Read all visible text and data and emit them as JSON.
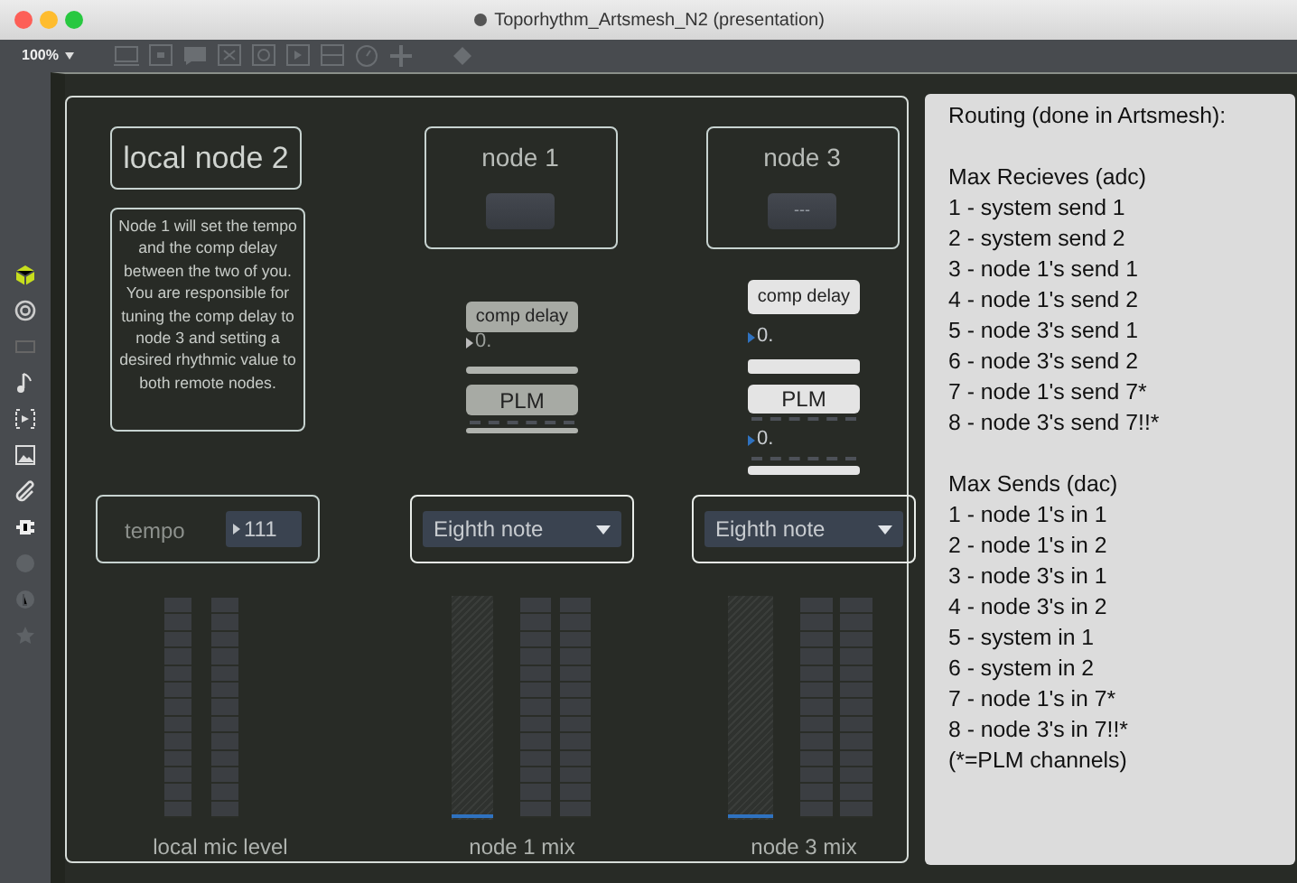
{
  "window": {
    "title": "Toporhythm_Artsmesh_N2 (presentation)"
  },
  "toolbar": {
    "zoom": "100%"
  },
  "local_node": {
    "title": "local node 2",
    "note": "Node 1 will set the tempo and the comp delay between the two of you. You are responsible for tuning the comp delay to node 3 and setting a desired rhythmic value to both remote nodes.",
    "tempo_label": "tempo",
    "tempo_value": "111",
    "meter_label": "local mic level"
  },
  "remote_nodes": [
    {
      "title": "node 1",
      "disabled": true,
      "comp_delay": "comp delay",
      "delay_value": "0.",
      "plm": "PLM",
      "rhythm": "Eighth note",
      "gain": {
        "level": 0.0
      },
      "mix_label": "node 1 mix"
    },
    {
      "title": "node 3",
      "button": "---",
      "disabled": false,
      "comp_delay": "comp delay",
      "delay_value": "0.",
      "plm": "PLM",
      "plm_value": "0.",
      "rhythm": "Eighth note",
      "gain": {
        "level": 0.0
      },
      "mix_label": "node 3 mix"
    }
  ],
  "routing": {
    "title": "Routing (done in Artsmesh):",
    "sections": [
      {
        "heading": "Max Recieves (adc)",
        "lines": [
          "1 - system send 1",
          "2 - system send 2",
          "3 - node 1's send 1",
          "4 - node 1's send 2",
          "5 - node 3's send 1",
          "6 - node 3's send 2",
          "7 - node 1's send 7*",
          "8 - node 3's send 7!!*"
        ]
      },
      {
        "heading": "Max Sends (dac)",
        "lines": [
          "1 - node 1's in 1",
          "2 - node 1's in 2",
          "3 - node 3's in 1",
          "4 - node 3's in 2",
          "5 - system in 1",
          "6 - system in 2",
          "7 - node 1's in 7*",
          "8 - node 3's in 7!!*"
        ]
      }
    ],
    "footnote": "(*=PLM channels)"
  }
}
